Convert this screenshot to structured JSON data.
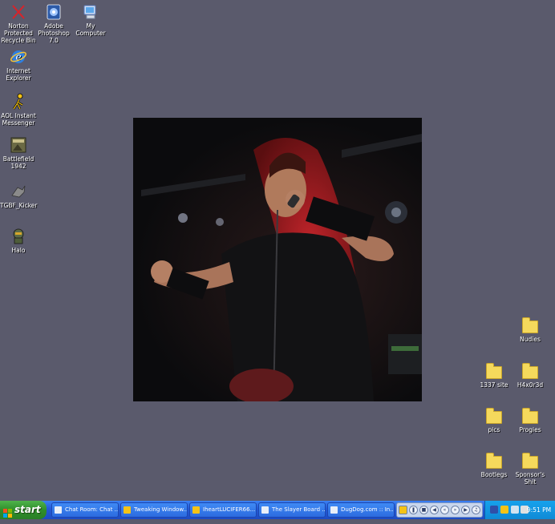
{
  "desktop": {
    "left_icons": [
      {
        "label": "Norton Protected Recycle Bin",
        "icon": "recycle-bin-icon"
      },
      {
        "label": "Internet Explorer",
        "icon": "internet-explorer-icon"
      },
      {
        "label": "AOL Instant Messenger",
        "icon": "aim-icon"
      },
      {
        "label": "Battlefield 1942",
        "icon": "battlefield-icon"
      },
      {
        "label": "TGBF_Kicker",
        "icon": "kicker-icon"
      },
      {
        "label": "Halo",
        "icon": "halo-icon"
      }
    ],
    "top_icons": [
      {
        "label": "Adobe Photoshop 7.0",
        "icon": "photoshop-icon"
      },
      {
        "label": "My Computer",
        "icon": "my-computer-icon"
      }
    ],
    "folders": [
      {
        "label": "Nudies"
      },
      {
        "label": "1337 site"
      },
      {
        "label": "H4x0r3d"
      },
      {
        "label": "pics"
      },
      {
        "label": "Progies"
      },
      {
        "label": "Bootlegs"
      },
      {
        "label": "Sponsor's Shit"
      }
    ],
    "colors": {
      "background": "#5a5a6c",
      "folder": "#f5d95c"
    }
  },
  "taskbar": {
    "start_label": "start",
    "tasks": [
      {
        "label": "Chat Room: Chat ..."
      },
      {
        "label": "Tweaking Window..."
      },
      {
        "label": "IheartLUCIFER66..."
      },
      {
        "label": "The Slayer Board ..."
      },
      {
        "label": "DugDog.com :: In..."
      }
    ],
    "media_controls": [
      "pause",
      "stop",
      "previous",
      "rewind",
      "fast-forward",
      "next",
      "volume"
    ],
    "clock": "9:51 PM"
  }
}
